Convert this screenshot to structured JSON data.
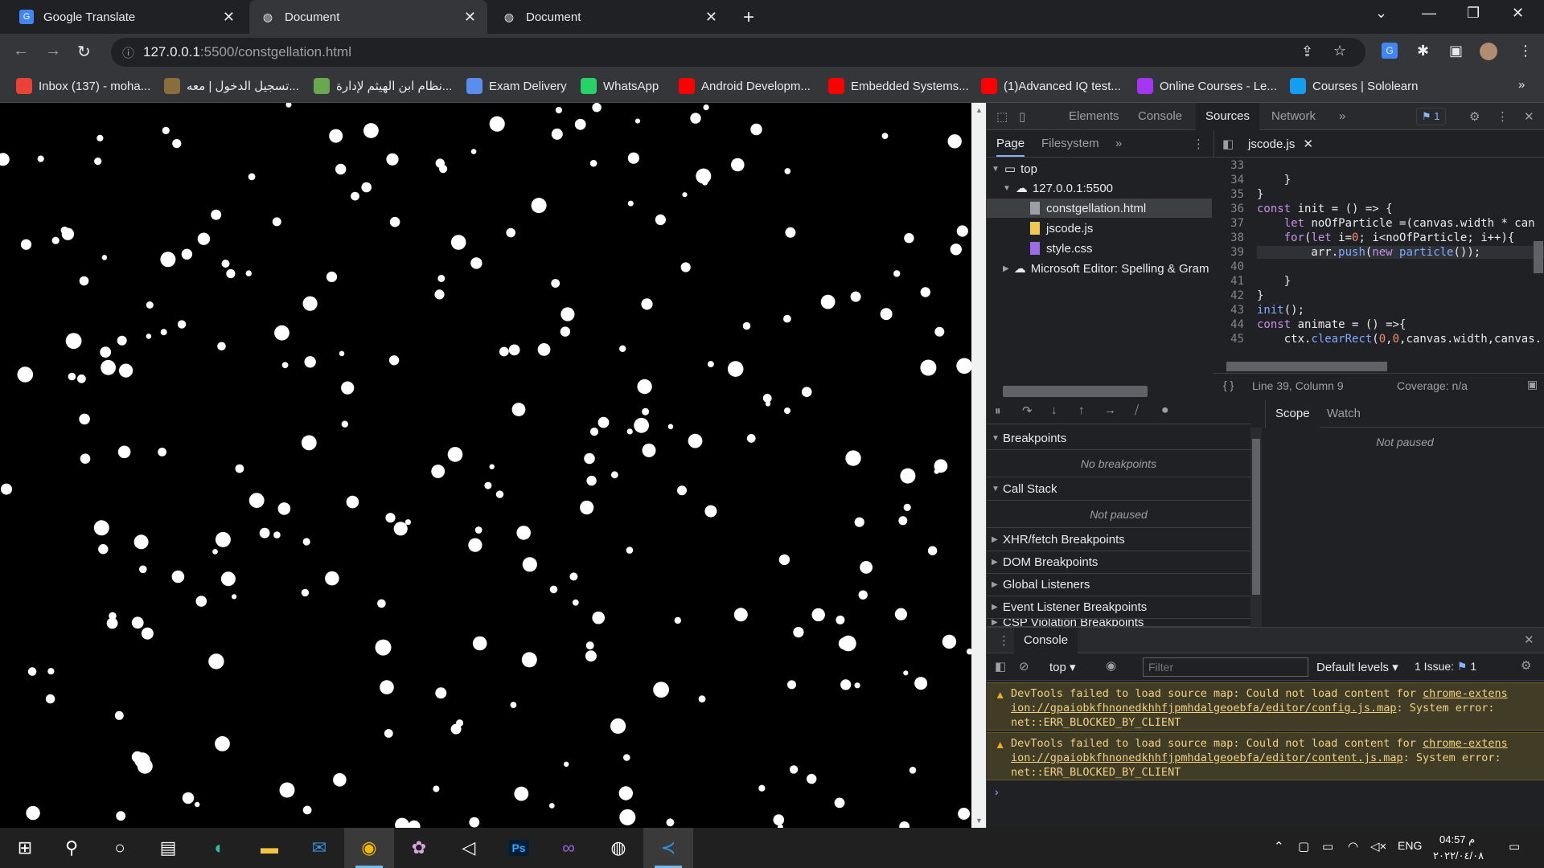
{
  "tabs": [
    {
      "title": "Google Translate",
      "icon": "google-translate-icon",
      "active": false
    },
    {
      "title": "Document",
      "icon": "globe-icon",
      "active": true
    },
    {
      "title": "Document",
      "icon": "globe-icon",
      "active": false
    }
  ],
  "omnibox": {
    "host": "127.0.0.1",
    "path": ":5500/constgellation.html"
  },
  "bookmarks": [
    {
      "label": "Inbox (137) - moha...",
      "icon": "gmail-icon",
      "color": "#ea4335"
    },
    {
      "label": "تسجيل الدخول | معه...",
      "icon": "institute-icon",
      "color": "#8a6d3b"
    },
    {
      "label": "نظام ابن الهيثم لإدارة...",
      "icon": "ibn-haytham-icon",
      "color": "#6aa84f"
    },
    {
      "label": "Exam Delivery",
      "icon": "exam-icon",
      "color": "#5b8def"
    },
    {
      "label": "WhatsApp",
      "icon": "whatsapp-icon",
      "color": "#25d366"
    },
    {
      "label": "Android Developm...",
      "icon": "youtube-icon",
      "color": "#ff0000"
    },
    {
      "label": "Embedded Systems...",
      "icon": "youtube-icon",
      "color": "#ff0000"
    },
    {
      "label": "(1)Advanced IQ test...",
      "icon": "youtube-icon",
      "color": "#ff0000"
    },
    {
      "label": "Online Courses - Le...",
      "icon": "udemy-icon",
      "color": "#a435f0"
    },
    {
      "label": "Courses | Sololearn",
      "icon": "sololearn-icon",
      "color": "#149ef2"
    }
  ],
  "devtools": {
    "tabs": [
      "Elements",
      "Console",
      "Sources",
      "Network"
    ],
    "active_tab": "Sources",
    "issues_count": "1",
    "nav_tabs": [
      "Page",
      "Filesystem"
    ],
    "file_tab": "jscode.js",
    "tree": {
      "top": "top",
      "origin": "127.0.0.1:5500",
      "files": [
        "constgellation.html",
        "jscode.js",
        "style.css"
      ],
      "extension": "Microsoft Editor: Spelling & Gram"
    },
    "code_lines": [
      {
        "n": "33",
        "text": ""
      },
      {
        "n": "34",
        "text": "    }"
      },
      {
        "n": "35",
        "text": "}"
      },
      {
        "n": "36",
        "text": "const init = () => {"
      },
      {
        "n": "37",
        "text": "    let noOfParticle =(canvas.width * can"
      },
      {
        "n": "38",
        "text": "    for(let i=0; i<noOfParticle; i++){"
      },
      {
        "n": "39",
        "text": "        arr.push(new particle());"
      },
      {
        "n": "40",
        "text": ""
      },
      {
        "n": "41",
        "text": "    }"
      },
      {
        "n": "42",
        "text": "}"
      },
      {
        "n": "43",
        "text": "init();"
      },
      {
        "n": "44",
        "text": "const animate = () =>{"
      },
      {
        "n": "45",
        "text": "    ctx.clearRect(0,0,canvas.width,canvas."
      }
    ],
    "status_position": "Line 39, Column 9",
    "coverage": "Coverage: n/a",
    "scope_tabs": [
      "Scope",
      "Watch"
    ],
    "not_paused": "Not paused",
    "breakpoints_title": "Breakpoints",
    "no_breakpoints": "No breakpoints",
    "call_stack_title": "Call Stack",
    "sections": [
      "XHR/fetch Breakpoints",
      "DOM Breakpoints",
      "Global Listeners",
      "Event Listener Breakpoints",
      "CSP Violation Breakpoints"
    ],
    "console": {
      "title": "Console",
      "context": "top",
      "filter_placeholder": "Filter",
      "levels": "Default levels",
      "issues": "1 Issue:",
      "issues_n": "1",
      "warnings": [
        {
          "pre": "DevTools failed to load source map: Could not load content for ",
          "url_a": "chrome-extens",
          "url_b": "ion://gpaiobkfhnonedkhhfjpmhdalgeoebfa/editor/config.js.map",
          "post": ": System error:",
          "err": "net::ERR_BLOCKED_BY_CLIENT"
        },
        {
          "pre": "DevTools failed to load source map: Could not load content for ",
          "url_a": "chrome-extens",
          "url_b": "ion://gpaiobkfhnonedkhhfjpmhdalgeoebfa/editor/content.js.map",
          "post": ": System error:",
          "err": "net::ERR_BLOCKED_BY_CLIENT"
        }
      ]
    }
  },
  "taskbar": {
    "apps": [
      "windows-start-icon",
      "search-icon",
      "cortana-icon",
      "task-view-icon",
      "edge-icon",
      "file-explorer-icon",
      "mail-icon",
      "chrome-icon",
      "paint-icon",
      "unity-icon",
      "photoshop-icon",
      "visual-studio-icon",
      "winamp-icon",
      "vscode-icon"
    ],
    "lang": "ENG",
    "time": "04:57 م",
    "date": "٢٠٢٢/٠٤/٠٨"
  },
  "canvas": {
    "background": "#000000",
    "particle_color": "#ffffff"
  }
}
